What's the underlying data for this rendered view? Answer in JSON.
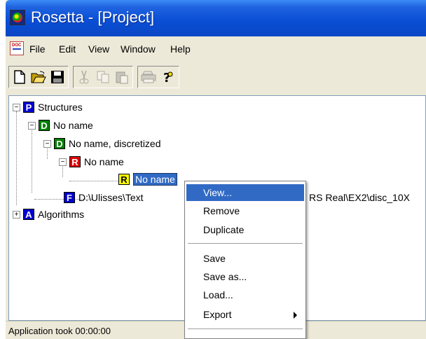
{
  "window": {
    "title": "Rosetta - [Project]"
  },
  "menubar": {
    "items": [
      "File",
      "Edit",
      "View",
      "Window",
      "Help"
    ],
    "doc_icon_text": "DOC"
  },
  "toolbar": {
    "buttons": [
      {
        "icon": "new-document-icon",
        "enabled": true
      },
      {
        "icon": "open-folder-icon",
        "enabled": true
      },
      {
        "icon": "save-disk-icon",
        "enabled": true
      },
      {
        "icon": "cut-scissors-icon",
        "enabled": false
      },
      {
        "icon": "copy-icon",
        "enabled": false
      },
      {
        "icon": "paste-icon",
        "enabled": false
      },
      {
        "icon": "print-icon",
        "enabled": false
      },
      {
        "icon": "help-question-icon",
        "enabled": true
      }
    ]
  },
  "tree": {
    "nodes": [
      {
        "letter": "P",
        "label": "Structures",
        "expander": "−",
        "colors": {
          "bg": "#0000d0",
          "fg": "#ffffff"
        }
      },
      {
        "letter": "D",
        "label": "No name",
        "expander": "−",
        "colors": {
          "bg": "#008000",
          "fg": "#ffffff"
        }
      },
      {
        "letter": "D",
        "label": "No name, discretized",
        "expander": "−",
        "colors": {
          "bg": "#008000",
          "fg": "#ffffff"
        }
      },
      {
        "letter": "R",
        "label": "No name",
        "expander": "−",
        "colors": {
          "bg": "#e00000",
          "fg": "#ffffff"
        }
      },
      {
        "letter": "R",
        "label": "No name",
        "expander": "",
        "colors": {
          "bg": "#ffff00",
          "fg": "#000000"
        },
        "selected": true
      },
      {
        "letter": "F",
        "label": "D:\\Ulisses\\Text",
        "label_tail": "RS Real\\EX2\\disc_10X",
        "expander": "",
        "colors": {
          "bg": "#0000d0",
          "fg": "#ffffff"
        }
      },
      {
        "letter": "A",
        "label": "Algorithms",
        "expander": "+",
        "colors": {
          "bg": "#0000d0",
          "fg": "#ffffff"
        }
      }
    ]
  },
  "context_menu": {
    "items": [
      {
        "label": "View...",
        "highlighted": true
      },
      {
        "label": "Remove"
      },
      {
        "label": "Duplicate"
      },
      {
        "separator": true
      },
      {
        "label": "Save"
      },
      {
        "label": "Save as..."
      },
      {
        "label": "Load..."
      },
      {
        "label": "Export",
        "submenu": true
      },
      {
        "separator": true
      }
    ]
  },
  "statusbar": {
    "text": "Application took 00:00:00"
  },
  "colors": {
    "titlebar": "#0a4fd6",
    "selection": "#316ac5",
    "chrome": "#ece9d8"
  }
}
